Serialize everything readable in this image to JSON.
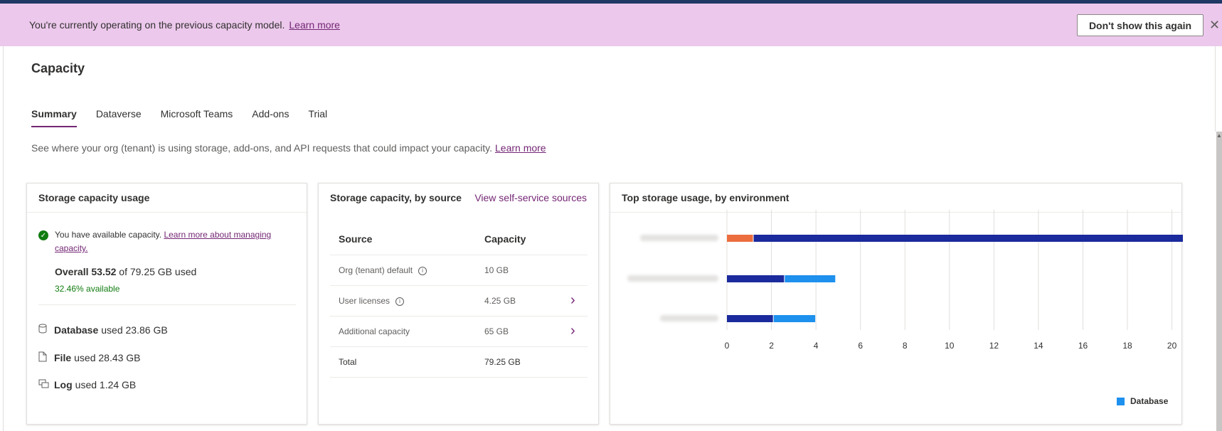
{
  "banner": {
    "message": "You're currently operating on the previous capacity model.",
    "link": "Learn more",
    "dismiss_button": "Don't show this again",
    "close": "✕"
  },
  "page": {
    "title": "Capacity",
    "description": "See where your org (tenant) is using storage, add-ons, and API requests that could impact your capacity.",
    "description_link": "Learn more"
  },
  "tabs": [
    {
      "label": "Summary",
      "active": true
    },
    {
      "label": "Dataverse",
      "active": false
    },
    {
      "label": "Microsoft Teams",
      "active": false
    },
    {
      "label": "Add-ons",
      "active": false
    },
    {
      "label": "Trial",
      "active": false
    }
  ],
  "storage_usage": {
    "title": "Storage capacity usage",
    "status_text": "You have available capacity.",
    "status_link": "Learn more about managing capacity.",
    "overall_label": "Overall 53.52",
    "overall_rest": "of 79.25 GB used",
    "available": "32.46% available",
    "items": [
      {
        "name": "Database",
        "value": "used 23.86 GB",
        "icon": "database-icon"
      },
      {
        "name": "File",
        "value": "used 28.43 GB",
        "icon": "file-icon"
      },
      {
        "name": "Log",
        "value": "used 1.24 GB",
        "icon": "log-icon"
      }
    ]
  },
  "storage_source": {
    "title": "Storage capacity, by source",
    "view_link": "View self-service sources",
    "headers": {
      "source": "Source",
      "capacity": "Capacity"
    },
    "rows": [
      {
        "source": "Org (tenant) default",
        "capacity": "10 GB",
        "info": true,
        "chevron": false
      },
      {
        "source": "User licenses",
        "capacity": "4.25 GB",
        "info": true,
        "chevron": true
      },
      {
        "source": "Additional capacity",
        "capacity": "65 GB",
        "info": false,
        "chevron": true
      },
      {
        "source": "Total",
        "capacity": "79.25 GB",
        "info": false,
        "chevron": false
      }
    ]
  },
  "top_storage": {
    "title": "Top storage usage, by environment",
    "legend": "Database",
    "colors": {
      "dark": "#1b2a9c",
      "light": "#1e90ee",
      "orange": "#ec6e3e"
    }
  },
  "chart_data": {
    "type": "bar",
    "orientation": "horizontal",
    "stacked": true,
    "categories": [
      "",
      "",
      ""
    ],
    "series": [
      {
        "name": "",
        "color": "#ec6e3e",
        "values": [
          1.2,
          0,
          0
        ]
      },
      {
        "name": "",
        "color": "#1b2a9c",
        "values": [
          20.3,
          2.6,
          2.1
        ]
      },
      {
        "name": "Database",
        "color": "#1e90ee",
        "values": [
          0,
          2.3,
          1.9
        ]
      }
    ],
    "x_ticks": [
      0,
      2,
      4,
      6,
      8,
      10,
      12,
      14,
      16,
      18,
      20
    ],
    "xlim": [
      0,
      20.3
    ],
    "grid": true,
    "legend": "bottom-right"
  }
}
